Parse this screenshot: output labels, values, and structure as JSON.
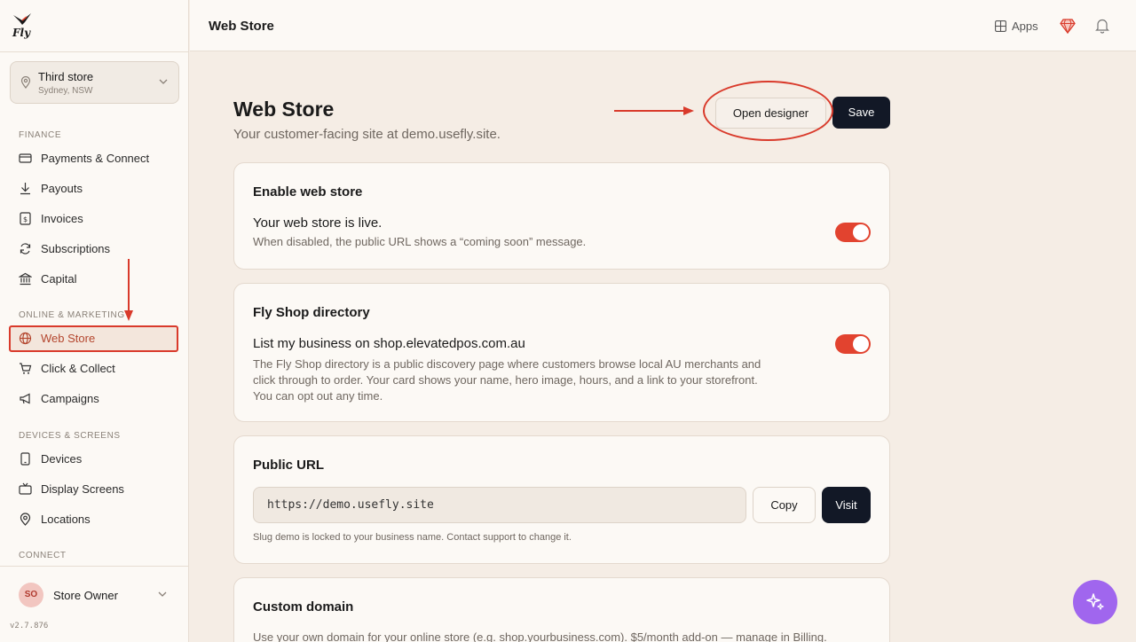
{
  "brand": {
    "logo_text": "Fly"
  },
  "store": {
    "name": "Third store",
    "location": "Sydney, NSW"
  },
  "sidebar": {
    "sections": [
      {
        "label": "FINANCE"
      },
      {
        "label": "ONLINE & MARKETING"
      },
      {
        "label": "DEVICES & SCREENS"
      },
      {
        "label": "CONNECT"
      }
    ],
    "items": [
      {
        "label": "Payments & Connect",
        "icon": "credit-card-icon"
      },
      {
        "label": "Payouts",
        "icon": "download-icon"
      },
      {
        "label": "Invoices",
        "icon": "dollar-doc-icon"
      },
      {
        "label": "Subscriptions",
        "icon": "refresh-icon"
      },
      {
        "label": "Capital",
        "icon": "bank-icon"
      },
      {
        "label": "Web Store",
        "icon": "globe-icon",
        "active": true
      },
      {
        "label": "Click & Collect",
        "icon": "cart-icon"
      },
      {
        "label": "Campaigns",
        "icon": "megaphone-icon"
      },
      {
        "label": "Devices",
        "icon": "tablet-icon"
      },
      {
        "label": "Display Screens",
        "icon": "tv-icon"
      },
      {
        "label": "Locations",
        "icon": "map-pin-icon"
      }
    ],
    "user": {
      "initials": "SO",
      "name": "Store Owner"
    },
    "version": "v2.7.876"
  },
  "topbar": {
    "title": "Web Store",
    "apps_label": "Apps"
  },
  "page": {
    "title": "Web Store",
    "subtitle": "Your customer-facing site at demo.usefly.site.",
    "open_designer_label": "Open designer",
    "save_label": "Save"
  },
  "cards": {
    "enable": {
      "title": "Enable web store",
      "row_title": "Your web store is live.",
      "row_desc": "When disabled, the public URL shows a “coming soon” message.",
      "enabled": true
    },
    "directory": {
      "title": "Fly Shop directory",
      "row_title": "List my business on shop.elevatedpos.com.au",
      "row_desc_1": "The Fly Shop directory is a public discovery page where customers browse local AU merchants and",
      "row_desc_2": "click through to order. Your card shows your name, hero image, hours, and a link to your storefront.",
      "row_desc_3": "You can opt out any time.",
      "enabled": true
    },
    "public_url": {
      "title": "Public URL",
      "url": "https://demo.usefly.site",
      "copy_label": "Copy",
      "visit_label": "Visit",
      "note": "Slug demo is locked to your business name. Contact support to change it."
    },
    "custom_domain": {
      "title": "Custom domain",
      "desc": "Use your own domain for your online store (e.g. shop.yourbusiness.com). $5/month add-on — manage in ",
      "billing_link": "Billing",
      "desc_end": "."
    }
  },
  "colors": {
    "accent": "#e2432f",
    "dark": "#121826",
    "fab": "#a066ee",
    "annotation": "#d93a2b"
  }
}
